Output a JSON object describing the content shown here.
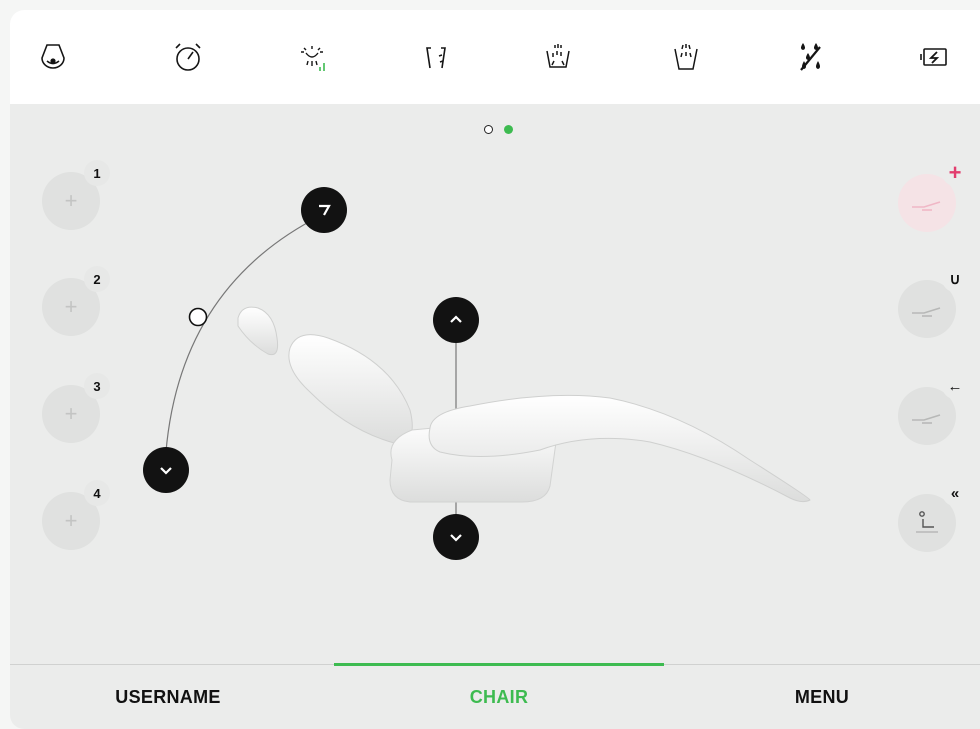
{
  "toolbar": {
    "icons": [
      {
        "name": "headrest-light-icon"
      },
      {
        "name": "timer-icon"
      },
      {
        "name": "operating-light-icon"
      },
      {
        "name": "cup-rinse-icon"
      },
      {
        "name": "bowl-rinse-icon"
      },
      {
        "name": "bowl-flush-icon"
      },
      {
        "name": "water-off-icon"
      },
      {
        "name": "battery-charge-icon"
      }
    ]
  },
  "pager": {
    "total": 2,
    "active": 2
  },
  "memory_positions": [
    {
      "number": "1",
      "symbol": "+"
    },
    {
      "number": "2",
      "symbol": "+"
    },
    {
      "number": "3",
      "symbol": "+"
    },
    {
      "number": "4",
      "symbol": "+"
    }
  ],
  "preset_positions": [
    {
      "name": "add-preset",
      "badge": "+",
      "badge_color": "#e23d6e"
    },
    {
      "name": "rinse-position",
      "badge": "∪"
    },
    {
      "name": "return-position",
      "badge": "←"
    },
    {
      "name": "entry-exit-position",
      "badge": "«"
    }
  ],
  "colors": {
    "accent": "#3dbb50",
    "add": "#e23d6e",
    "control": "#121212",
    "background": "#ebeceb"
  },
  "nav": {
    "tabs": [
      {
        "label": "USERNAME"
      },
      {
        "label": "CHAIR",
        "active": true
      },
      {
        "label": "MENU"
      }
    ]
  }
}
